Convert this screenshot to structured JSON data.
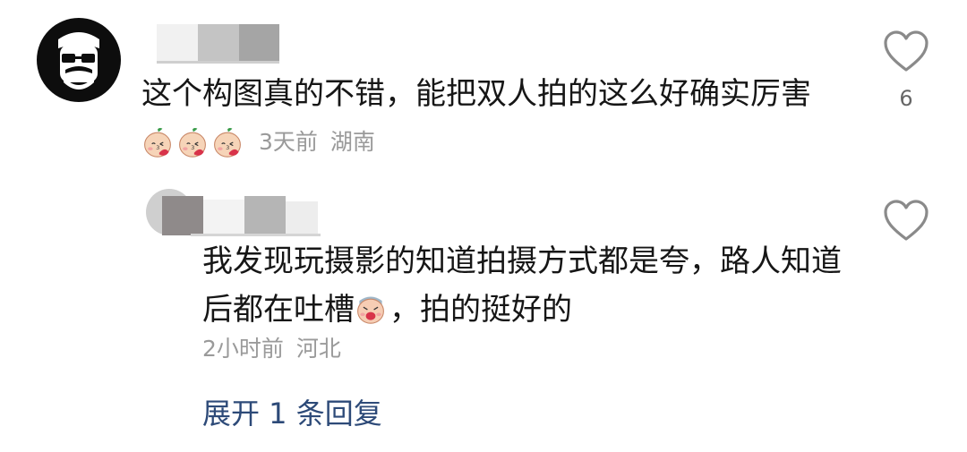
{
  "comment": {
    "text": "这个构图真的不错，能把双人拍的这么好确实厉害",
    "time": "3天前",
    "location": "湖南",
    "like_count": "6"
  },
  "reply": {
    "text_part1": "我发现玩摄影的知道拍摄方式都是夸，路人知道后都在吐槽",
    "text_part2": "，拍的挺好的",
    "time": "2小时前",
    "location": "河北"
  },
  "expand_replies": {
    "label": "展开 1 条回复"
  },
  "icons": {
    "like": "heart-outline-icon",
    "emoji_blush": "blushing-peach-emoji",
    "emoji_cry": "crying-peach-emoji"
  },
  "colors": {
    "text": "#161616",
    "meta": "#9a9a9a",
    "link": "#2d4a78",
    "heart_stroke": "#8a8a8a"
  }
}
